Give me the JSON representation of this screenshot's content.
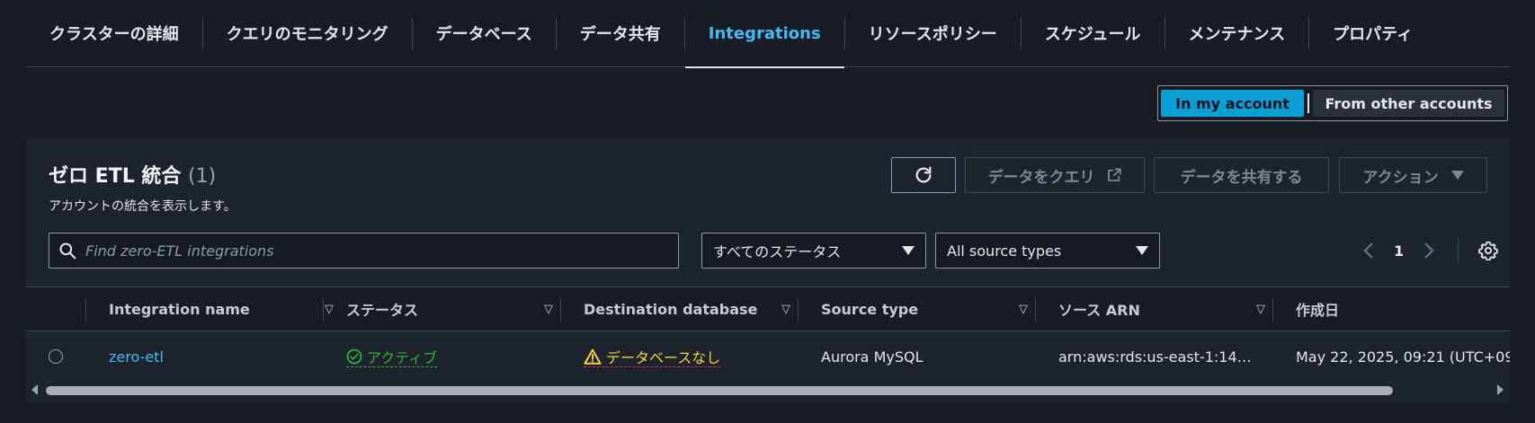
{
  "tabs": [
    {
      "label": "クラスターの詳細"
    },
    {
      "label": "クエリのモニタリング"
    },
    {
      "label": "データベース"
    },
    {
      "label": "データ共有"
    },
    {
      "label": "Integrations"
    },
    {
      "label": "リソースポリシー"
    },
    {
      "label": "スケジュール"
    },
    {
      "label": "メンテナンス"
    },
    {
      "label": "プロパティ"
    }
  ],
  "active_tab": "Integrations",
  "account_toggle": {
    "in_my_account": "In my account",
    "from_other_accounts": "From other accounts"
  },
  "panel": {
    "title": "ゼロ ETL 統合",
    "count": "(1)",
    "subtitle": "アカウントの統合を表示します。",
    "query_button": "データをクエリ",
    "share_button": "データを共有する",
    "action_button": "アクション"
  },
  "filters": {
    "search_placeholder": "Find zero-ETL integrations",
    "status_select": "すべてのステータス",
    "source_select": "All source types"
  },
  "pagination": {
    "page": "1"
  },
  "table": {
    "columns": [
      "Integration name",
      "ステータス",
      "Destination database",
      "Source type",
      "ソース ARN",
      "作成日"
    ],
    "rows": [
      {
        "name": "zero-etl",
        "status": "アクティブ",
        "destination": "データベースなし",
        "source_type": "Aurora MySQL",
        "source_arn": "arn:aws:rds:us-east-1:14…",
        "created": "May 22, 2025, 09:21 (UTC+09:"
      }
    ]
  },
  "colors": {
    "accent": "#44b9f6",
    "toggle_on": "#0a9fd5",
    "status_ok": "#2bb534",
    "status_warn": "#fbd332",
    "warn_underline": "#e0245e"
  }
}
